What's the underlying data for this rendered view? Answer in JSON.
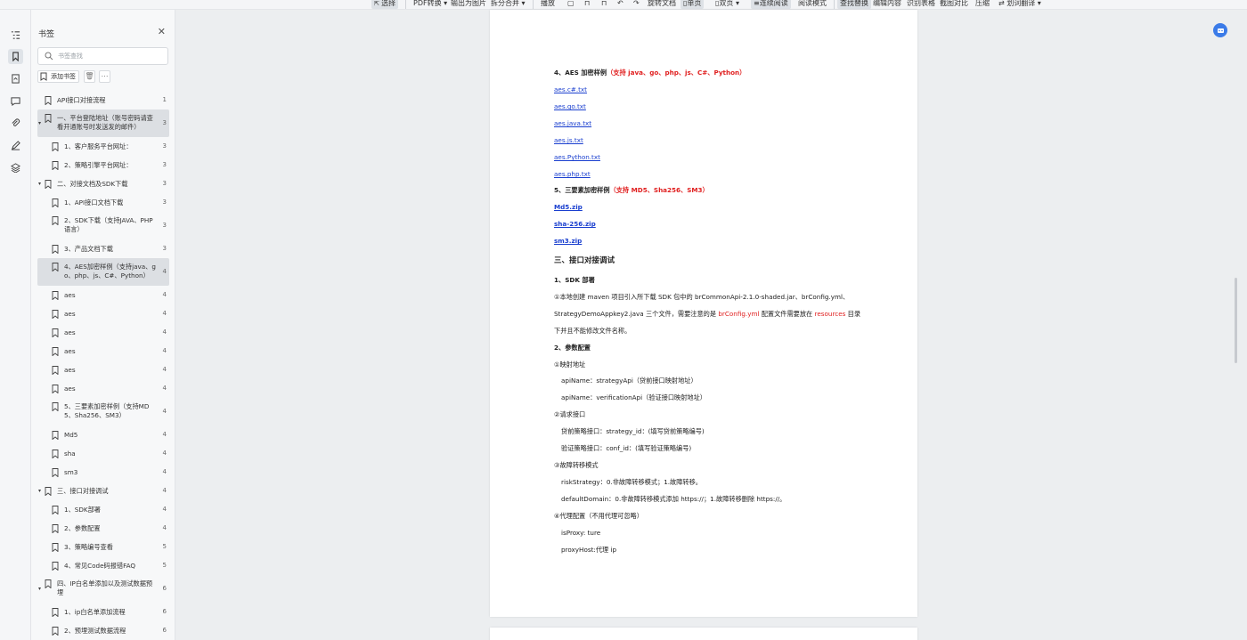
{
  "toolbar": {
    "items": [
      "选择",
      "PDF转换",
      "输出为图片",
      "拆分合并",
      "播放",
      "旋转文档",
      "单页",
      "双页",
      "连续阅读",
      "阅读模式",
      "查找替换",
      "编辑内容",
      "识别表格",
      "截图对比",
      "压缩",
      "划词翻译"
    ]
  },
  "sidebar": {
    "title": "书签",
    "search_placeholder": "书签查找",
    "add_label": "添加书签",
    "bookmarks": [
      {
        "label": "API接口对接流程",
        "page": "1",
        "caret": "",
        "selected": false
      },
      {
        "label": "一、平台登陆地址（账号密码请查看开通账号时发送发的邮件）",
        "page": "3",
        "caret": "▾",
        "selected": true
      },
      {
        "label": "1、客户服务平台网址：",
        "page": "3",
        "caret": "",
        "selected": false
      },
      {
        "label": "2、策略引擎平台网址：",
        "page": "3",
        "caret": "",
        "selected": false
      },
      {
        "label": "二、对接文档及SDK下载",
        "page": "3",
        "caret": "▾",
        "selected": false
      },
      {
        "label": "1、API接口文档下载",
        "page": "3",
        "caret": "",
        "selected": false
      },
      {
        "label": "2、SDK下载（支持JAVA、PHP语言）",
        "page": "3",
        "caret": "",
        "selected": false
      },
      {
        "label": "3、产品文档下载",
        "page": "3",
        "caret": "",
        "selected": false
      },
      {
        "label": "4、AES加密样例（支持java、go、php、js、C#、Python）",
        "page": "4",
        "caret": "",
        "selected": true
      },
      {
        "label": "aes",
        "page": "4",
        "caret": "",
        "selected": false
      },
      {
        "label": "aes",
        "page": "4",
        "caret": "",
        "selected": false
      },
      {
        "label": "aes",
        "page": "4",
        "caret": "",
        "selected": false
      },
      {
        "label": "aes",
        "page": "4",
        "caret": "",
        "selected": false
      },
      {
        "label": "aes",
        "page": "4",
        "caret": "",
        "selected": false
      },
      {
        "label": "aes",
        "page": "4",
        "caret": "",
        "selected": false
      },
      {
        "label": "5、三要素加密样例（支持MD5、Sha256、SM3）",
        "page": "4",
        "caret": "",
        "selected": false
      },
      {
        "label": "Md5",
        "page": "4",
        "caret": "",
        "selected": false
      },
      {
        "label": "sha",
        "page": "4",
        "caret": "",
        "selected": false
      },
      {
        "label": "sm3",
        "page": "4",
        "caret": "",
        "selected": false
      },
      {
        "label": "三、接口对接调试",
        "page": "4",
        "caret": "▾",
        "selected": false
      },
      {
        "label": "1、SDK部署",
        "page": "4",
        "caret": "",
        "selected": false
      },
      {
        "label": "2、参数配置",
        "page": "4",
        "caret": "",
        "selected": false
      },
      {
        "label": "3、策略编号查看",
        "page": "5",
        "caret": "",
        "selected": false
      },
      {
        "label": "4、常见Code码报错FAQ",
        "page": "5",
        "caret": "",
        "selected": false
      },
      {
        "label": "四、IP白名单添加以及测试数据预埋",
        "page": "6",
        "caret": "▾",
        "selected": false
      },
      {
        "label": "1、ip白名单添加流程",
        "page": "6",
        "caret": "",
        "selected": false
      },
      {
        "label": "2、预埋测试数据流程",
        "page": "6",
        "caret": "",
        "selected": false
      }
    ]
  },
  "document": {
    "aes_heading": "4、AES 加密样例",
    "aes_heading_red": "（支持 java、go、php、js、C#、Python）",
    "aes_files": [
      "aes.c#.txt",
      "aes.go.txt",
      "aes.java.txt",
      "aes.js.txt",
      "aes.Python.txt",
      "aes.php.txt"
    ],
    "three_heading": "5、三要素加密样例",
    "three_heading_red": "（支持 MD5、Sha256、SM3）",
    "three_files": [
      "Md5.zip",
      "sha-256.zip",
      "sm3.zip"
    ],
    "section3_title": "三、接口对接调试",
    "sdk_title": "1、SDK 部署",
    "sdk_line1": "①本地创建 maven 项目引入所下载 SDK 包中的 brCommonApi-2.1.0-shaded.jar、brConfig.yml、",
    "sdk_line2_a": "StrategyDemoAppkey2.java 三个文件，需要注意的是 ",
    "sdk_line2_red1": "brConfig.yml",
    "sdk_line2_b": " 配置文件需要放在 ",
    "sdk_line2_red2": "resources",
    "sdk_line2_c": " 目录",
    "sdk_line3": "下并且不能修改文件名称。",
    "param_title": "2、参数配置",
    "mapping_title": "①映射地址",
    "mapping_1": "apiName：strategyApi（贷前接口映射地址）",
    "mapping_2": "apiName：verificationApi（验证接口映射地址）",
    "request_title": "②请求接口",
    "request_1": "贷前策略接口：strategy_id：(填写贷前策略编号)",
    "request_2": "验证策略接口：conf_id：(填写验证策略编号)",
    "fault_title": "③故障转移模式",
    "fault_1": "riskStrategy：0.非故障转移模式；1.故障转移。",
    "fault_2": "defaultDomain：0.非故障转移模式添加 https://；1.故障转移删除 https://。",
    "proxy_title": "④代理配置（不用代理可忽略）",
    "proxy_1": "isProxy: ture",
    "proxy_2": "proxyHost:代理 ip"
  },
  "colors": {
    "accent": "#3b7be8",
    "link": "#1a3fcf",
    "red": "#e02020"
  }
}
